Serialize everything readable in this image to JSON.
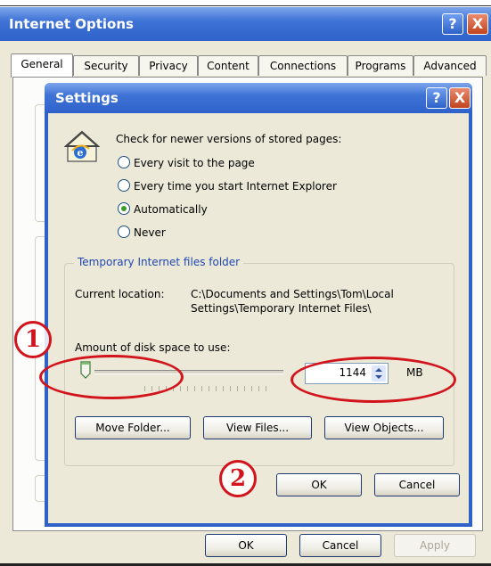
{
  "outer": {
    "title": "Internet Options",
    "help_glyph": "?",
    "close_glyph": "X",
    "tabs": [
      "General",
      "Security",
      "Privacy",
      "Content",
      "Connections",
      "Programs",
      "Advanced"
    ],
    "ok_label": "OK",
    "cancel_label": "Cancel",
    "apply_label": "Apply"
  },
  "settings": {
    "title": "Settings",
    "help_glyph": "?",
    "close_glyph": "X",
    "prompt": "Check for newer versions of stored pages:",
    "options": [
      {
        "label": "Every visit to the page",
        "selected": false
      },
      {
        "label": "Every time you start Internet Explorer",
        "selected": false
      },
      {
        "label": "Automatically",
        "selected": true
      },
      {
        "label": "Never",
        "selected": false
      }
    ],
    "group_title": "Temporary Internet files folder",
    "current_location_label": "Current location:",
    "current_location_line1": "C:\\Documents and Settings\\Tom\\Local",
    "current_location_line2": "Settings\\Temporary Internet Files\\",
    "disk_space_label": "Amount of disk space to use:",
    "disk_space_value": "1144",
    "disk_space_unit": "MB",
    "slider_level": 0.02,
    "move_folder_label": "Move Folder...",
    "view_files_label": "View Files...",
    "view_objects_label": "View Objects...",
    "ok_label": "OK",
    "cancel_label": "Cancel"
  },
  "annotations": {
    "marker_1": "1",
    "marker_2": "2",
    "color": "#d2141d"
  },
  "icons": [
    "help-icon",
    "close-icon",
    "ie-page-icon",
    "spinner-arrows-icon",
    "slider-thumb-icon"
  ]
}
